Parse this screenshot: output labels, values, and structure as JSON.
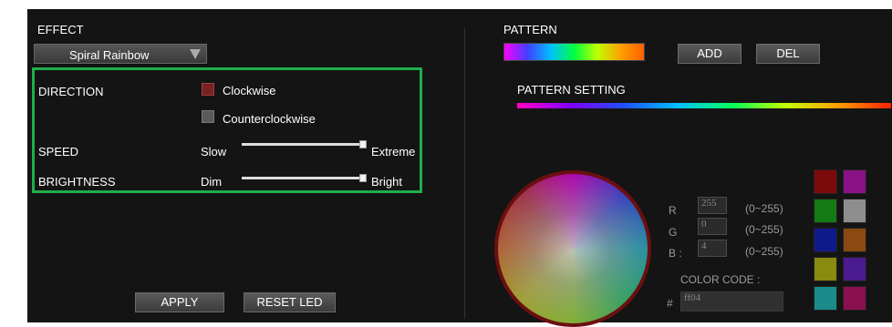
{
  "effect": {
    "title": "EFFECT",
    "selected": "Spiral Rainbow",
    "direction_label": "DIRECTION",
    "direction_options": [
      "Clockwise",
      "Counterclockwise"
    ],
    "speed_label": "SPEED",
    "speed_min": "Slow",
    "speed_max": "Extreme",
    "speed_value": 1.0,
    "brightness_label": "BRIGHTNESS",
    "brightness_min": "Dim",
    "brightness_max": "Bright",
    "brightness_value": 1.0,
    "apply_label": "APPLY",
    "reset_label": "RESET LED"
  },
  "pattern": {
    "title": "PATTERN",
    "add_label": "ADD",
    "del_label": "DEL",
    "setting_title": "PATTERN SETTING",
    "r_label": "R",
    "g_label": "G",
    "b_label": "B :",
    "r_value": "255",
    "g_value": "0",
    "b_value": "4",
    "range_label": "(0~255)",
    "color_code_label": "COLOR CODE :",
    "hash_label": "#",
    "color_code_value": "ff04",
    "swatches": [
      "#7d0a0a",
      "#8a1186",
      "#147a14",
      "#8e8e8e",
      "#0f1a8a",
      "#8a4a12",
      "#8a8a10",
      "#4a1a90",
      "#1a8a8a",
      "#8a1050"
    ]
  },
  "colors": {
    "checkbox_on": "#7a2020",
    "checkbox_off": "#5a5a5a",
    "highlight": "#1fae4b"
  }
}
